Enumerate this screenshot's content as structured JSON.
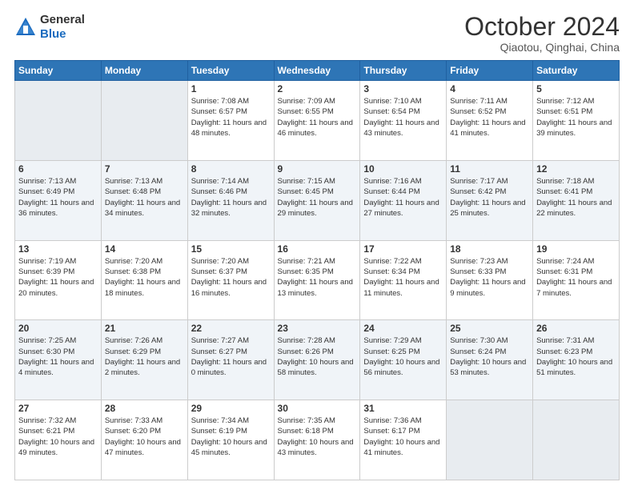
{
  "logo": {
    "general": "General",
    "blue": "Blue"
  },
  "header": {
    "title": "October 2024",
    "subtitle": "Qiaotou, Qinghai, China"
  },
  "weekdays": [
    "Sunday",
    "Monday",
    "Tuesday",
    "Wednesday",
    "Thursday",
    "Friday",
    "Saturday"
  ],
  "weeks": [
    [
      {
        "day": "",
        "info": ""
      },
      {
        "day": "",
        "info": ""
      },
      {
        "day": "1",
        "info": "Sunrise: 7:08 AM\nSunset: 6:57 PM\nDaylight: 11 hours and 48 minutes."
      },
      {
        "day": "2",
        "info": "Sunrise: 7:09 AM\nSunset: 6:55 PM\nDaylight: 11 hours and 46 minutes."
      },
      {
        "day": "3",
        "info": "Sunrise: 7:10 AM\nSunset: 6:54 PM\nDaylight: 11 hours and 43 minutes."
      },
      {
        "day": "4",
        "info": "Sunrise: 7:11 AM\nSunset: 6:52 PM\nDaylight: 11 hours and 41 minutes."
      },
      {
        "day": "5",
        "info": "Sunrise: 7:12 AM\nSunset: 6:51 PM\nDaylight: 11 hours and 39 minutes."
      }
    ],
    [
      {
        "day": "6",
        "info": "Sunrise: 7:13 AM\nSunset: 6:49 PM\nDaylight: 11 hours and 36 minutes."
      },
      {
        "day": "7",
        "info": "Sunrise: 7:13 AM\nSunset: 6:48 PM\nDaylight: 11 hours and 34 minutes."
      },
      {
        "day": "8",
        "info": "Sunrise: 7:14 AM\nSunset: 6:46 PM\nDaylight: 11 hours and 32 minutes."
      },
      {
        "day": "9",
        "info": "Sunrise: 7:15 AM\nSunset: 6:45 PM\nDaylight: 11 hours and 29 minutes."
      },
      {
        "day": "10",
        "info": "Sunrise: 7:16 AM\nSunset: 6:44 PM\nDaylight: 11 hours and 27 minutes."
      },
      {
        "day": "11",
        "info": "Sunrise: 7:17 AM\nSunset: 6:42 PM\nDaylight: 11 hours and 25 minutes."
      },
      {
        "day": "12",
        "info": "Sunrise: 7:18 AM\nSunset: 6:41 PM\nDaylight: 11 hours and 22 minutes."
      }
    ],
    [
      {
        "day": "13",
        "info": "Sunrise: 7:19 AM\nSunset: 6:39 PM\nDaylight: 11 hours and 20 minutes."
      },
      {
        "day": "14",
        "info": "Sunrise: 7:20 AM\nSunset: 6:38 PM\nDaylight: 11 hours and 18 minutes."
      },
      {
        "day": "15",
        "info": "Sunrise: 7:20 AM\nSunset: 6:37 PM\nDaylight: 11 hours and 16 minutes."
      },
      {
        "day": "16",
        "info": "Sunrise: 7:21 AM\nSunset: 6:35 PM\nDaylight: 11 hours and 13 minutes."
      },
      {
        "day": "17",
        "info": "Sunrise: 7:22 AM\nSunset: 6:34 PM\nDaylight: 11 hours and 11 minutes."
      },
      {
        "day": "18",
        "info": "Sunrise: 7:23 AM\nSunset: 6:33 PM\nDaylight: 11 hours and 9 minutes."
      },
      {
        "day": "19",
        "info": "Sunrise: 7:24 AM\nSunset: 6:31 PM\nDaylight: 11 hours and 7 minutes."
      }
    ],
    [
      {
        "day": "20",
        "info": "Sunrise: 7:25 AM\nSunset: 6:30 PM\nDaylight: 11 hours and 4 minutes."
      },
      {
        "day": "21",
        "info": "Sunrise: 7:26 AM\nSunset: 6:29 PM\nDaylight: 11 hours and 2 minutes."
      },
      {
        "day": "22",
        "info": "Sunrise: 7:27 AM\nSunset: 6:27 PM\nDaylight: 11 hours and 0 minutes."
      },
      {
        "day": "23",
        "info": "Sunrise: 7:28 AM\nSunset: 6:26 PM\nDaylight: 10 hours and 58 minutes."
      },
      {
        "day": "24",
        "info": "Sunrise: 7:29 AM\nSunset: 6:25 PM\nDaylight: 10 hours and 56 minutes."
      },
      {
        "day": "25",
        "info": "Sunrise: 7:30 AM\nSunset: 6:24 PM\nDaylight: 10 hours and 53 minutes."
      },
      {
        "day": "26",
        "info": "Sunrise: 7:31 AM\nSunset: 6:23 PM\nDaylight: 10 hours and 51 minutes."
      }
    ],
    [
      {
        "day": "27",
        "info": "Sunrise: 7:32 AM\nSunset: 6:21 PM\nDaylight: 10 hours and 49 minutes."
      },
      {
        "day": "28",
        "info": "Sunrise: 7:33 AM\nSunset: 6:20 PM\nDaylight: 10 hours and 47 minutes."
      },
      {
        "day": "29",
        "info": "Sunrise: 7:34 AM\nSunset: 6:19 PM\nDaylight: 10 hours and 45 minutes."
      },
      {
        "day": "30",
        "info": "Sunrise: 7:35 AM\nSunset: 6:18 PM\nDaylight: 10 hours and 43 minutes."
      },
      {
        "day": "31",
        "info": "Sunrise: 7:36 AM\nSunset: 6:17 PM\nDaylight: 10 hours and 41 minutes."
      },
      {
        "day": "",
        "info": ""
      },
      {
        "day": "",
        "info": ""
      }
    ]
  ]
}
